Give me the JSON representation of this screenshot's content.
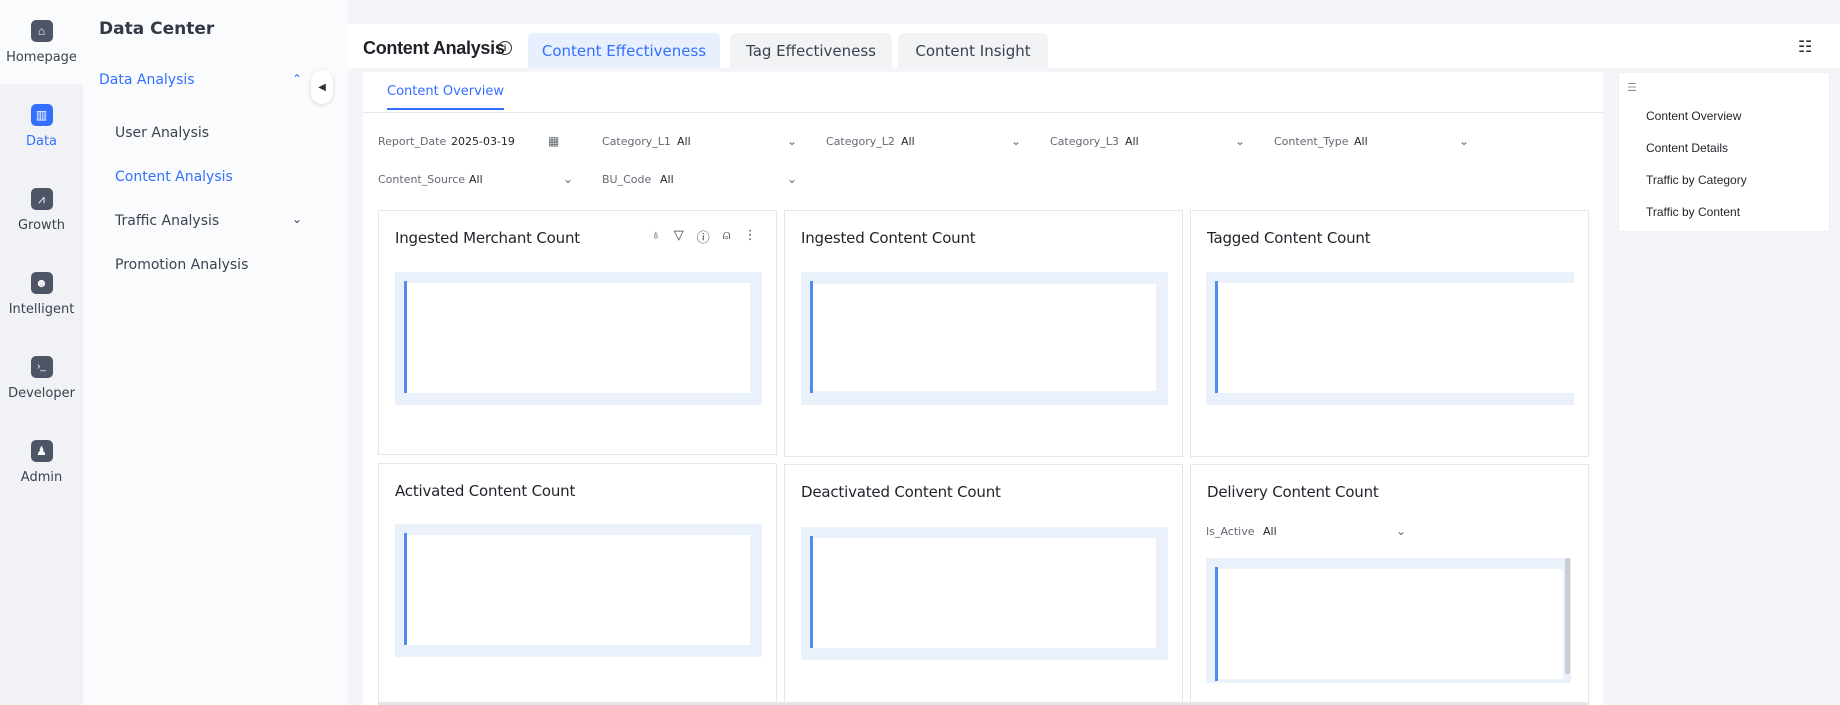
{
  "rail": [
    {
      "label": "Homepage",
      "icon": "home-icon",
      "glyph": "⌂"
    },
    {
      "label": "Data",
      "icon": "bar-chart-icon",
      "glyph": "▥"
    },
    {
      "label": "Growth",
      "icon": "trend-icon",
      "glyph": "⩘"
    },
    {
      "label": "Intelligent",
      "icon": "robot-icon",
      "glyph": "☻"
    },
    {
      "label": "Developer",
      "icon": "terminal-icon",
      "glyph": "›_"
    },
    {
      "label": "Admin",
      "icon": "user-admin-icon",
      "glyph": "♟"
    }
  ],
  "subnav": {
    "title": "Data Center",
    "group": "Data Analysis",
    "items": [
      "User Analysis",
      "Content Analysis",
      "Traffic Analysis",
      "Promotion Analysis"
    ]
  },
  "header": {
    "title": "Content Analysis",
    "tabs": [
      "Content Effectiveness",
      "Tag Effectiveness",
      "Content Insight"
    ]
  },
  "main": {
    "sub_tab": "Content Overview",
    "filters": [
      {
        "label": "Report_Date",
        "value": "2025-03-19"
      },
      {
        "label": "Category_L1",
        "value": "All"
      },
      {
        "label": "Category_L2",
        "value": "All"
      },
      {
        "label": "Category_L3",
        "value": "All"
      },
      {
        "label": "Content_Type",
        "value": "All"
      },
      {
        "label": "Content_Source",
        "value": "All"
      },
      {
        "label": "BU_Code",
        "value": "All"
      }
    ],
    "cards": [
      "Ingested Merchant Count",
      "Ingested Content Count",
      "Tagged Content Count",
      "Activated Content Count",
      "Deactivated Content Count",
      "Delivery Content Count"
    ],
    "delivery_filter": {
      "label": "Is_Active",
      "value": "All"
    }
  },
  "outline": [
    "Content Overview",
    "Content Details",
    "Traffic by Category",
    "Traffic by Content"
  ],
  "colors": {
    "accent": "#3370ff",
    "chart_bg": "#ebf1fb",
    "axis": "#4e8cf0"
  }
}
